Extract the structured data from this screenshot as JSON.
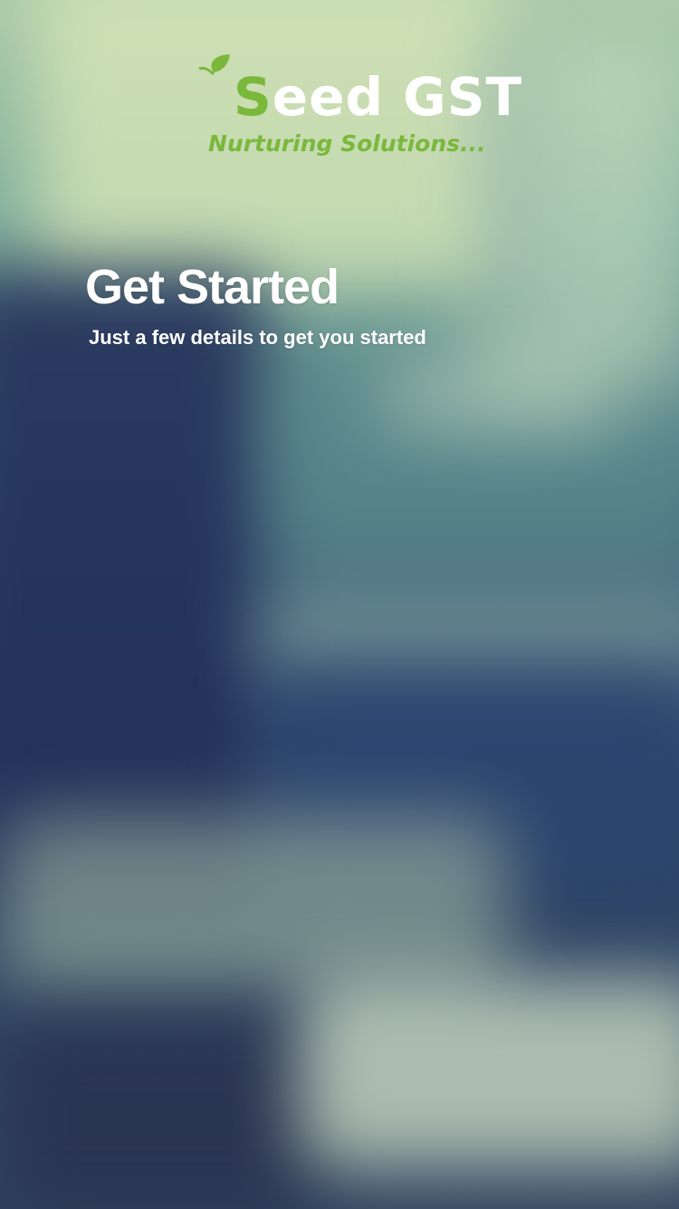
{
  "brand": {
    "logo_initial": "S",
    "logo_rest": "eed GST",
    "tagline": "Nurturing Solutions..."
  },
  "header": {
    "title": "Get Started",
    "subtitle": "Just a few details to get you started"
  },
  "colors": {
    "brand_green": "#7ab83c",
    "text": "#ffffff"
  },
  "icons": {
    "logo_mark": "seed-sprout-icon"
  }
}
